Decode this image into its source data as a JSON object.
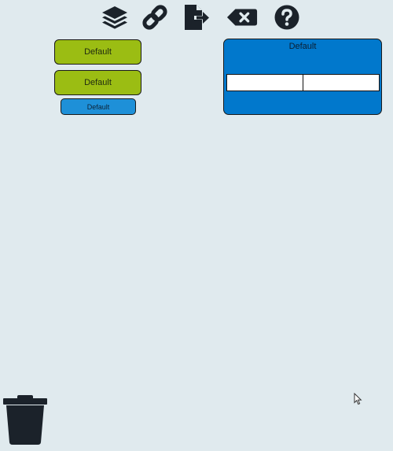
{
  "toolbar": {
    "icons": [
      "layers-icon",
      "link-icon",
      "export-file-icon",
      "backspace-icon",
      "help-icon"
    ]
  },
  "buttons": {
    "green_1_label": "Default",
    "green_2_label": "Default",
    "blue_label": "Default"
  },
  "panel": {
    "title": "Default",
    "field_left_value": "",
    "field_right_value": ""
  },
  "footer": {
    "icon": "trash-icon"
  },
  "colors": {
    "background": "#e0eaee",
    "green_button": "#9bbd13",
    "blue_button": "#1e90d8",
    "panel": "#0178cc",
    "icon": "#1b222a"
  }
}
